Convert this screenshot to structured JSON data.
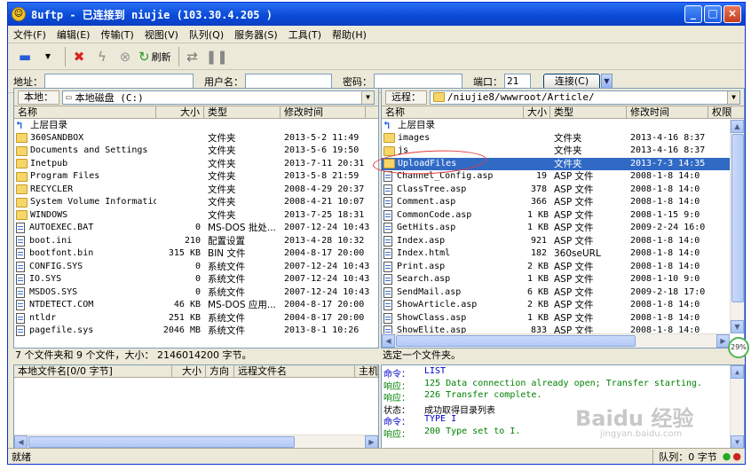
{
  "window": {
    "title": "8uftp - 已连接到 niujie (103.30.4.205  )",
    "minimize": "_",
    "maximize": "□",
    "close": "×"
  },
  "menu": [
    "文件(F)",
    "编辑(E)",
    "传输(T)",
    "视图(V)",
    "队列(Q)",
    "服务器(S)",
    "工具(T)",
    "帮助(H)"
  ],
  "toolbar": {
    "refresh_label": "刷新"
  },
  "address": {
    "host_label": "地址：",
    "host_value": "",
    "user_label": "用户名：",
    "user_value": "",
    "pass_label": "密码：",
    "pass_value": "",
    "port_label": "端口：",
    "port_value": "21",
    "connect_label": "连接(C)"
  },
  "local": {
    "tag": "本地：",
    "path": "本地磁盘 (C:)",
    "columns": [
      "名称",
      "大小",
      "类型",
      "修改时间"
    ],
    "up_label": "上层目录",
    "files": [
      {
        "name": "360SANDBOX",
        "size": "",
        "type": "文件夹",
        "date": "2013-5-2 11:49",
        "kind": "folder"
      },
      {
        "name": "Documents and Settings",
        "size": "",
        "type": "文件夹",
        "date": "2013-5-6 19:50",
        "kind": "folder"
      },
      {
        "name": "Inetpub",
        "size": "",
        "type": "文件夹",
        "date": "2013-7-11 20:31",
        "kind": "folder"
      },
      {
        "name": "Program Files",
        "size": "",
        "type": "文件夹",
        "date": "2013-5-8 21:59",
        "kind": "folder"
      },
      {
        "name": "RECYCLER",
        "size": "",
        "type": "文件夹",
        "date": "2008-4-29 20:37",
        "kind": "folder"
      },
      {
        "name": "System Volume Information",
        "size": "",
        "type": "文件夹",
        "date": "2008-4-21 10:07",
        "kind": "folder"
      },
      {
        "name": "WINDOWS",
        "size": "",
        "type": "文件夹",
        "date": "2013-7-25 18:31",
        "kind": "folder"
      },
      {
        "name": "AUTOEXEC.BAT",
        "size": "0",
        "type": "MS-DOS 批处...",
        "date": "2007-12-24 10:43",
        "kind": "file"
      },
      {
        "name": "boot.ini",
        "size": "210",
        "type": "配置设置",
        "date": "2013-4-28 10:32",
        "kind": "file"
      },
      {
        "name": "bootfont.bin",
        "size": "315 KB",
        "type": "BIN 文件",
        "date": "2004-8-17 20:00",
        "kind": "file"
      },
      {
        "name": "CONFIG.SYS",
        "size": "0",
        "type": "系统文件",
        "date": "2007-12-24 10:43",
        "kind": "file"
      },
      {
        "name": "IO.SYS",
        "size": "0",
        "type": "系统文件",
        "date": "2007-12-24 10:43",
        "kind": "file"
      },
      {
        "name": "MSDOS.SYS",
        "size": "0",
        "type": "系统文件",
        "date": "2007-12-24 10:43",
        "kind": "file"
      },
      {
        "name": "NTDETECT.COM",
        "size": "46 KB",
        "type": "MS-DOS 应用...",
        "date": "2004-8-17 20:00",
        "kind": "file"
      },
      {
        "name": "ntldr",
        "size": "251 KB",
        "type": "系统文件",
        "date": "2004-8-17 20:00",
        "kind": "file"
      },
      {
        "name": "pagefile.sys",
        "size": "2046 MB",
        "type": "系统文件",
        "date": "2013-8-1 10:26",
        "kind": "file"
      }
    ],
    "status": "7 个文件夹和 9 个文件，大小： 2146014200 字节。"
  },
  "remote": {
    "tag": "远程：",
    "path": "/niujie8/wwwroot/Article/",
    "columns": [
      "名称",
      "大小",
      "类型",
      "修改时间",
      "权限"
    ],
    "up_label": "上层目录",
    "files": [
      {
        "name": "images",
        "size": "",
        "type": "文件夹",
        "date": "2013-4-16 8:37",
        "kind": "folder"
      },
      {
        "name": "js",
        "size": "",
        "type": "文件夹",
        "date": "2013-4-16 8:37",
        "kind": "folder"
      },
      {
        "name": "UploadFiles",
        "size": "",
        "type": "文件夹",
        "date": "2013-7-3 14:35",
        "kind": "folder",
        "selected": true
      },
      {
        "name": "Channel_Config.asp",
        "size": "19",
        "type": "ASP 文件",
        "date": "2008-1-8 14:0",
        "kind": "file"
      },
      {
        "name": "ClassTree.asp",
        "size": "378",
        "type": "ASP 文件",
        "date": "2008-1-8 14:0",
        "kind": "file"
      },
      {
        "name": "Comment.asp",
        "size": "366",
        "type": "ASP 文件",
        "date": "2008-1-8 14:0",
        "kind": "file"
      },
      {
        "name": "CommonCode.asp",
        "size": "1 KB",
        "type": "ASP 文件",
        "date": "2008-1-15 9:0",
        "kind": "file"
      },
      {
        "name": "GetHits.asp",
        "size": "1 KB",
        "type": "ASP 文件",
        "date": "2009-2-24 16:0",
        "kind": "file"
      },
      {
        "name": "Index.asp",
        "size": "921",
        "type": "ASP 文件",
        "date": "2008-1-8 14:0",
        "kind": "file"
      },
      {
        "name": "Index.html",
        "size": "182",
        "type": "360seURL",
        "date": "2008-1-8 14:0",
        "kind": "file"
      },
      {
        "name": "Print.asp",
        "size": "2 KB",
        "type": "ASP 文件",
        "date": "2008-1-8 14:0",
        "kind": "file"
      },
      {
        "name": "Search.asp",
        "size": "1 KB",
        "type": "ASP 文件",
        "date": "2008-1-10 9:0",
        "kind": "file"
      },
      {
        "name": "SendMail.asp",
        "size": "6 KB",
        "type": "ASP 文件",
        "date": "2009-2-18 17:0",
        "kind": "file"
      },
      {
        "name": "ShowArticle.asp",
        "size": "2 KB",
        "type": "ASP 文件",
        "date": "2008-1-8 14:0",
        "kind": "file"
      },
      {
        "name": "ShowClass.asp",
        "size": "1 KB",
        "type": "ASP 文件",
        "date": "2008-1-8 14:0",
        "kind": "file"
      },
      {
        "name": "ShowElite.asp",
        "size": "833",
        "type": "ASP 文件",
        "date": "2008-1-8 14:0",
        "kind": "file"
      }
    ],
    "status": "选定一个文件夹。"
  },
  "queue": {
    "columns": [
      "本地文件名[0/0 字节]",
      "大小",
      "方向",
      "远程文件名",
      "主机"
    ]
  },
  "log": [
    {
      "key": "命令：",
      "text": "LIST",
      "kind": "cmd"
    },
    {
      "key": "响应：",
      "text": "125 Data connection already open; Transfer starting.",
      "kind": "resp"
    },
    {
      "key": "响应：",
      "text": "226 Transfer complete.",
      "kind": "resp"
    },
    {
      "key": "状态：",
      "text": "成功取得目录列表",
      "kind": "stat"
    },
    {
      "key": "命令：",
      "text": "TYPE I",
      "kind": "cmd"
    },
    {
      "key": "响应：",
      "text": "200 Type set to I.",
      "kind": "resp"
    }
  ],
  "statusbar": {
    "left": "就绪",
    "queue": "队列：0 字节"
  },
  "overlay": {
    "percent": "29%",
    "watermark": "Baidu 经验",
    "watermark_url": "jingyan.baidu.com"
  }
}
